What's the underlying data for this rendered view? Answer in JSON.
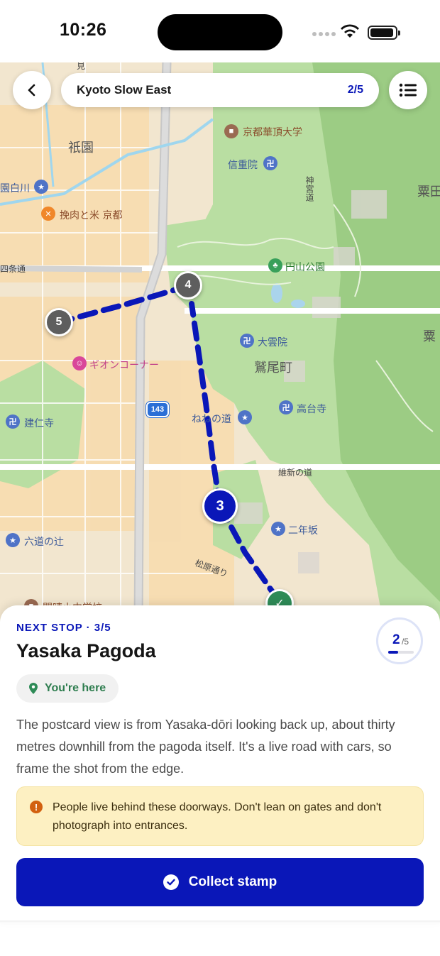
{
  "status": {
    "time": "10:26"
  },
  "header": {
    "route_name": "Kyoto Slow East",
    "route_progress": "2/5"
  },
  "map": {
    "labels": {
      "gion": "祇園",
      "kyoto_kacho": "京都華頂大学",
      "shinren": "信重院",
      "shirakawa": "園白川",
      "hikiniku": "挽肉と米 京都",
      "shijo": "四条通",
      "maruyama": "円山公園",
      "daiunin": "大雲院",
      "washio": "鷲尾町",
      "gion_corner": "ギオンコーナー",
      "kodaiji": "高台寺",
      "nene": "ねねの道",
      "kenninji": "建仁寺",
      "ishin": "維新の道",
      "ninenzaka": "二年坂",
      "rokudo": "六道の辻",
      "matsubara": "松原通り",
      "shinguu": "神宮道",
      "awata1": "粟田",
      "awata2": "粟",
      "kaisei": "開晴小中学校",
      "mi": "見",
      "route_143": "143"
    },
    "stops": [
      {
        "number": "3",
        "state": "current"
      },
      {
        "number": "4",
        "state": "upcoming"
      },
      {
        "number": "5",
        "state": "upcoming"
      }
    ]
  },
  "sheet": {
    "next_stop_label": "NEXT STOP · 3/5",
    "stop_title": "Yasaka Pagoda",
    "collected_count": "2",
    "collected_total": "/5",
    "collected_fraction": 0.4,
    "here_label": "You're here",
    "description": "The postcard view is from Yasaka-dōri looking back up, about thirty metres downhill from the pagoda itself. It's a live road with cars, so frame the shot from the edge.",
    "warning": "People live behind these doorways. Don't lean on gates and don't photograph into entrances.",
    "collect_label": "Collect stamp"
  },
  "colors": {
    "accent": "#0a17b8",
    "success": "#2e8b57",
    "warning_bg": "#fdf0c2",
    "warning_icon": "#d2600f"
  }
}
